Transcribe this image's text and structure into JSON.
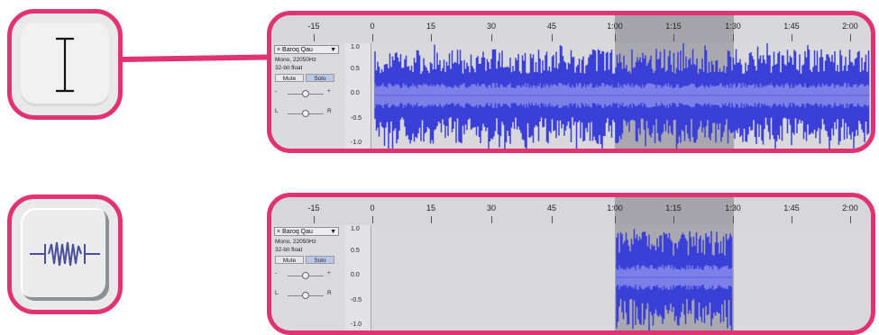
{
  "timeline_ticks": [
    "-15",
    "0",
    "15",
    "30",
    "45",
    "1:00",
    "1:15",
    "1:30",
    "1:45",
    "2:00"
  ],
  "track": {
    "name": "Baroq Qau",
    "menu_arrow": "▼",
    "info_line1": "Mono, 22050Hz",
    "info_line2": "32-bit float",
    "mute_label": "Mute",
    "solo_label": "Solo",
    "gain_minus": "-",
    "gain_plus": "+",
    "pan_left": "L",
    "pan_right": "R"
  },
  "amplitude_scale": [
    "1.0",
    "0.5",
    "0.0",
    "-0.5",
    "-1.0"
  ],
  "tools": {
    "selection_tool_icon": "i-beam-icon",
    "trim_tool_icon": "trim-audio-icon"
  },
  "colors": {
    "highlight_frame": "#e0336f",
    "waveform": "#3a3fd8",
    "waveform_rms": "#7b7fe8",
    "selection": "#a4a4aa"
  }
}
